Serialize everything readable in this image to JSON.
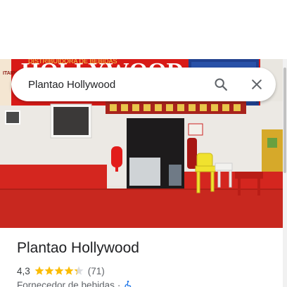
{
  "search": {
    "value": "Plantao Hollywood",
    "search_icon": "search-icon",
    "close_icon": "close-icon"
  },
  "photo": {
    "sign_text": "HOLLYWOOD",
    "sign_top_text": "DISTRIBUIDORA DE BEBIDAS",
    "left_panel_text": "ITAIPAVA"
  },
  "place": {
    "name": "Plantao Hollywood",
    "rating": "4,3",
    "stars": 4.3,
    "review_count": "(71)",
    "category": "Fornecedor de bebidas",
    "separator": "·",
    "accessibility_icon": "wheelchair-icon"
  },
  "colors": {
    "star": "#fbbc04",
    "star_empty": "#dadce0",
    "accessibility": "#1a73e8",
    "sign_red": "#d81a17",
    "floor_red": "#c8281f"
  }
}
